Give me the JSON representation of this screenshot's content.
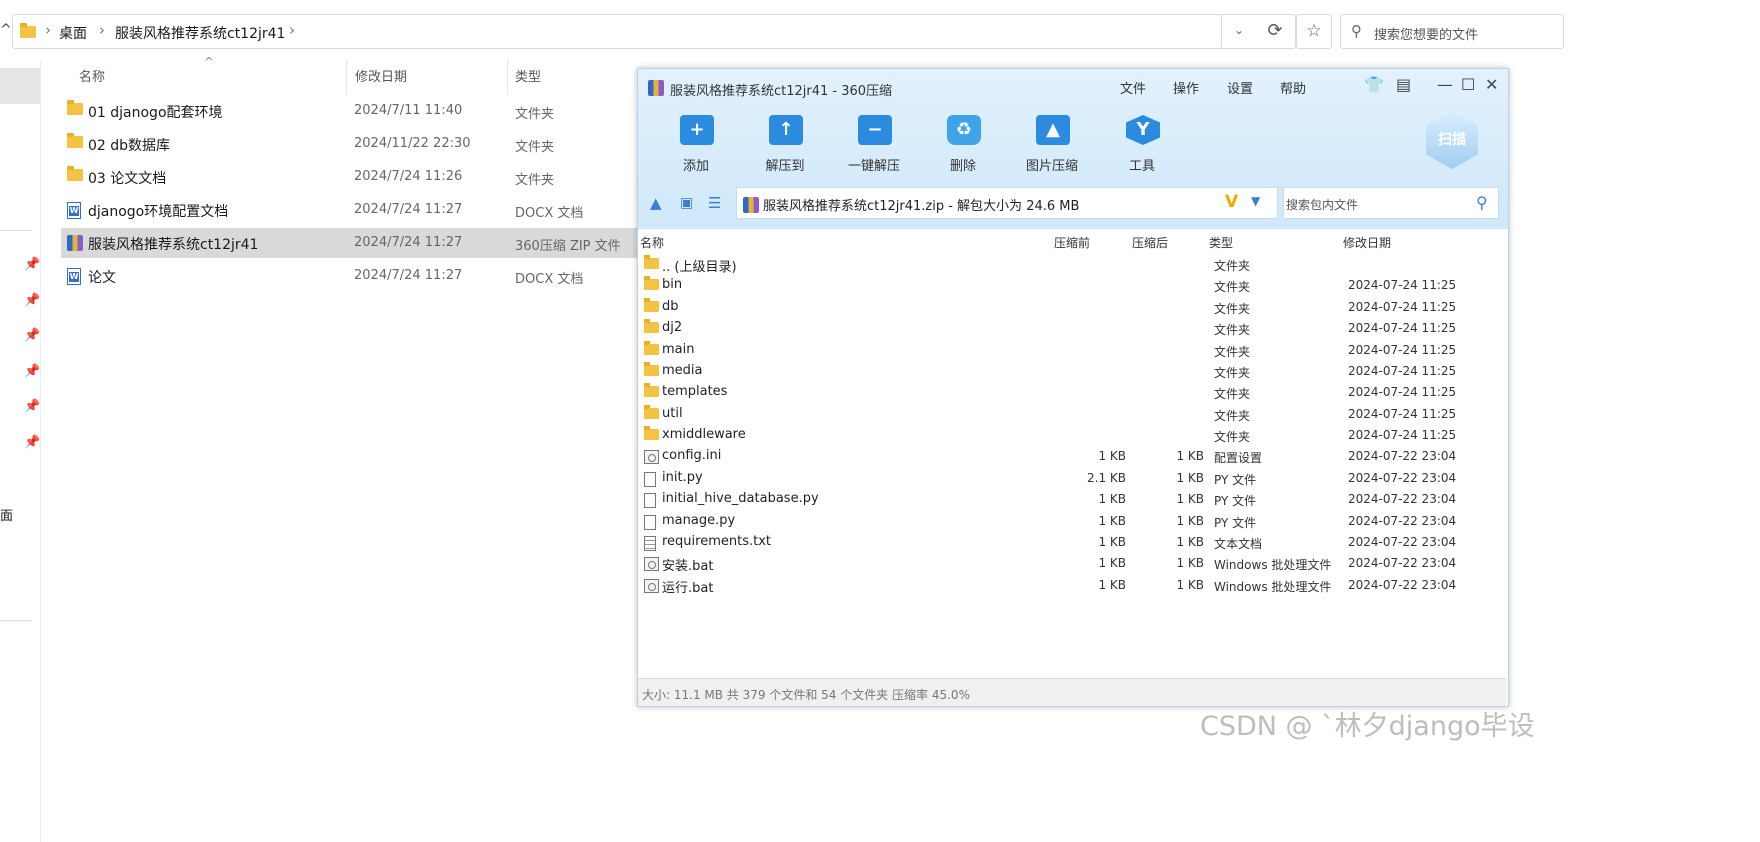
{
  "explorer": {
    "breadcrumb": [
      "桌面",
      "服装风格推荐系统ct12jr41"
    ],
    "search_placeholder": "搜索您想要的文件",
    "nav_desktop_partial": "面",
    "columns": {
      "name": "名称",
      "date": "修改日期",
      "type": "类型"
    },
    "files": [
      {
        "icon": "folder-icon",
        "name": "01 djanogo配套环境",
        "date": "2024/7/11 11:40",
        "type": "文件夹"
      },
      {
        "icon": "folder-icon",
        "name": "02 db数据库",
        "date": "2024/11/22 22:30",
        "type": "文件夹"
      },
      {
        "icon": "folder-icon",
        "name": "03 论文文档",
        "date": "2024/7/24 11:26",
        "type": "文件夹"
      },
      {
        "icon": "word-doc-icon",
        "name": "djanogo环境配置文档",
        "date": "2024/7/24 11:27",
        "type": "DOCX 文档"
      },
      {
        "icon": "zip-archive-icon",
        "name": "服装风格推荐系统ct12jr41",
        "date": "2024/7/24 11:27",
        "type": "360压缩 ZIP 文件",
        "selected": true
      },
      {
        "icon": "word-doc-icon",
        "name": "论文",
        "date": "2024/7/24 11:27",
        "type": "DOCX 文档"
      }
    ]
  },
  "archiver": {
    "title": "服装风格推荐系统ct12jr41 - 360压缩",
    "menu": [
      "文件",
      "操作",
      "设置",
      "帮助"
    ],
    "toolbar": [
      {
        "label": "添加",
        "icon": "add-icon"
      },
      {
        "label": "解压到",
        "icon": "extract-to-icon"
      },
      {
        "label": "一键解压",
        "icon": "one-click-extract-icon"
      },
      {
        "label": "删除",
        "icon": "recycle-icon"
      },
      {
        "label": "图片压缩",
        "icon": "image-compress-icon"
      },
      {
        "label": "工具",
        "icon": "tools-icon"
      }
    ],
    "scan_label": "扫描",
    "path_text": "服装风格推荐系统ct12jr41.zip - 解包大小为 24.6 MB",
    "search_placeholder": "搜索包内文件",
    "columns": {
      "name": "名称",
      "before": "压缩前",
      "after": "压缩后",
      "type": "类型",
      "date": "修改日期"
    },
    "entries": [
      {
        "icon": "folder-icon",
        "name": ".. (上级目录)",
        "before": "",
        "after": "",
        "type": "文件夹",
        "date": ""
      },
      {
        "icon": "folder-icon",
        "name": "bin",
        "before": "",
        "after": "",
        "type": "文件夹",
        "date": "2024-07-24 11:25"
      },
      {
        "icon": "folder-icon",
        "name": "db",
        "before": "",
        "after": "",
        "type": "文件夹",
        "date": "2024-07-24 11:25"
      },
      {
        "icon": "folder-icon",
        "name": "dj2",
        "before": "",
        "after": "",
        "type": "文件夹",
        "date": "2024-07-24 11:25"
      },
      {
        "icon": "folder-icon",
        "name": "main",
        "before": "",
        "after": "",
        "type": "文件夹",
        "date": "2024-07-24 11:25"
      },
      {
        "icon": "folder-icon",
        "name": "media",
        "before": "",
        "after": "",
        "type": "文件夹",
        "date": "2024-07-24 11:25"
      },
      {
        "icon": "folder-icon",
        "name": "templates",
        "before": "",
        "after": "",
        "type": "文件夹",
        "date": "2024-07-24 11:25"
      },
      {
        "icon": "folder-icon",
        "name": "util",
        "before": "",
        "after": "",
        "type": "文件夹",
        "date": "2024-07-24 11:25"
      },
      {
        "icon": "folder-icon",
        "name": "xmiddleware",
        "before": "",
        "after": "",
        "type": "文件夹",
        "date": "2024-07-24 11:25"
      },
      {
        "icon": "config-file-icon",
        "name": "config.ini",
        "before": "1 KB",
        "after": "1 KB",
        "type": "配置设置",
        "date": "2024-07-22 23:04"
      },
      {
        "icon": "file-icon",
        "name": "init.py",
        "before": "2.1 KB",
        "after": "1 KB",
        "type": "PY 文件",
        "date": "2024-07-22 23:04"
      },
      {
        "icon": "file-icon",
        "name": "initial_hive_database.py",
        "before": "1 KB",
        "after": "1 KB",
        "type": "PY 文件",
        "date": "2024-07-22 23:04"
      },
      {
        "icon": "file-icon",
        "name": "manage.py",
        "before": "1 KB",
        "after": "1 KB",
        "type": "PY 文件",
        "date": "2024-07-22 23:04"
      },
      {
        "icon": "text-file-icon",
        "name": "requirements.txt",
        "before": "1 KB",
        "after": "1 KB",
        "type": "文本文档",
        "date": "2024-07-22 23:04"
      },
      {
        "icon": "batch-file-icon",
        "name": "安装.bat",
        "before": "1 KB",
        "after": "1 KB",
        "type": "Windows 批处理文件",
        "date": "2024-07-22 23:04"
      },
      {
        "icon": "batch-file-icon",
        "name": "运行.bat",
        "before": "1 KB",
        "after": "1 KB",
        "type": "Windows 批处理文件",
        "date": "2024-07-22 23:04"
      }
    ],
    "status": "大小: 11.1 MB 共 379 个文件和 54 个文件夹 压缩率 45.0%"
  },
  "watermark": "CSDN @ ˋ林夕django毕设"
}
